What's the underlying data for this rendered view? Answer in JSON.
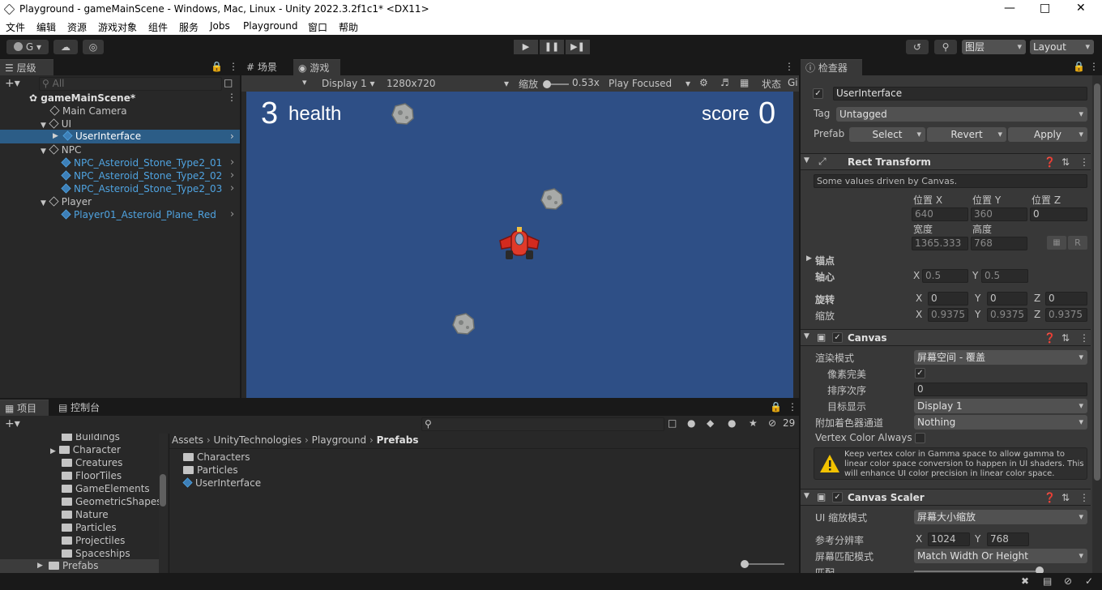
{
  "window": {
    "title": "Playground - gameMainScene - Windows, Mac, Linux - Unity 2022.3.2f1c1* <DX11>"
  },
  "menu": [
    "文件",
    "编辑",
    "资源",
    "游戏对象",
    "组件",
    "服务",
    "Jobs",
    "Playground",
    "窗口",
    "帮助"
  ],
  "toolbar": {
    "account": "G",
    "layers_label": "图层",
    "layout_label": "Layout"
  },
  "hierarchy": {
    "tab": "层级",
    "search_placeholder": "All",
    "scene_name": "gameMainScene*",
    "items": [
      {
        "label": "Main Camera",
        "color": "#c4c4c4"
      },
      {
        "label": "UI",
        "color": "#c4c4c4"
      },
      {
        "label": "UserInterface",
        "color": "#ffffff"
      },
      {
        "label": "NPC",
        "color": "#c4c4c4"
      },
      {
        "label": "NPC_Asteroid_Stone_Type2_01",
        "color": "#4fa3e0"
      },
      {
        "label": "NPC_Asteroid_Stone_Type2_02",
        "color": "#4fa3e0"
      },
      {
        "label": "NPC_Asteroid_Stone_Type2_03",
        "color": "#4fa3e0"
      },
      {
        "label": "Player",
        "color": "#c4c4c4"
      },
      {
        "label": "Player01_Asteroid_Plane_Red",
        "color": "#4fa3e0"
      }
    ]
  },
  "game_view": {
    "scene_tab": "场景",
    "game_tab": "游戏",
    "display": "Display 1",
    "resolution": "1280x720",
    "scale_label": "缩放",
    "scale_value": "0.53x",
    "play_mode": "Play Focused",
    "stats_label": "状态",
    "gizmos_label": "Gi",
    "hud_health_num": "3",
    "hud_health_text": "health",
    "hud_score_text": "score",
    "hud_score_num": "0"
  },
  "project": {
    "tab_project": "项目",
    "tab_console": "控制台",
    "hidden_count": "29",
    "tree": [
      "Buildings",
      "Character",
      "Creatures",
      "FloorTiles",
      "GameElements",
      "GeometricShapes",
      "Nature",
      "Particles",
      "Projectiles",
      "Spaceships",
      "Prefabs"
    ],
    "breadcrumb": [
      "Assets",
      "UnityTechnologies",
      "Playground",
      "Prefabs"
    ],
    "files": [
      "Characters",
      "Particles",
      "UserInterface"
    ]
  },
  "inspector": {
    "tab": "检查器",
    "object_name": "UserInterface",
    "tag_label": "Tag",
    "tag_value": "Untagged",
    "prefab_label": "Prefab",
    "prefab_select": "Select",
    "prefab_revert": "Revert",
    "prefab_apply": "Apply",
    "rect_transform": {
      "title": "Rect Transform",
      "note": "Some values driven by Canvas.",
      "pos_x_label": "位置 X",
      "pos_y_label": "位置 Y",
      "pos_z_label": "位置 Z",
      "pos_x": "640",
      "pos_y": "360",
      "pos_z": "0",
      "width_label": "宽度",
      "height_label": "高度",
      "width": "1365.333",
      "height": "768",
      "anchors_label": "锚点",
      "pivot_label": "轴心",
      "pivot_x": "0.5",
      "pivot_y": "0.5",
      "rotation_label": "旋转",
      "rot_x": "0",
      "rot_y": "0",
      "rot_z": "0",
      "scale_label": "缩放",
      "scale_x": "0.9375",
      "scale_y": "0.9375",
      "scale_z": "0.9375",
      "btn_r": "R"
    },
    "canvas": {
      "title": "Canvas",
      "render_mode_label": "渲染模式",
      "render_mode": "屏幕空间 - 覆盖",
      "pixel_perfect_label": "像素完美",
      "sort_order_label": "排序次序",
      "sort_order": "0",
      "target_display_label": "目标显示",
      "target_display": "Display 1",
      "additional_channels_label": "附加着色器通道",
      "additional_channels": "Nothing",
      "vertex_color_label": "Vertex Color Always",
      "warning": "Keep vertex color in Gamma space to allow gamma to linear color space conversion to happen in UI shaders. This will enhance UI color precision in linear color space."
    },
    "canvas_scaler": {
      "title": "Canvas Scaler",
      "scale_mode_label": "UI 缩放模式",
      "scale_mode": "屏幕大小缩放",
      "ref_res_label": "参考分辨率",
      "ref_x": "1024",
      "ref_y": "768",
      "match_mode_label": "屏幕匹配模式",
      "match_mode": "Match Width Or Height",
      "match_label": "匹配"
    },
    "axis": {
      "x": "X",
      "y": "Y",
      "z": "Z"
    }
  },
  "colors": {
    "game_bg": "#2e4f86",
    "selected_row": "#2c5d87",
    "accent_blue": "#4fa3e0"
  }
}
